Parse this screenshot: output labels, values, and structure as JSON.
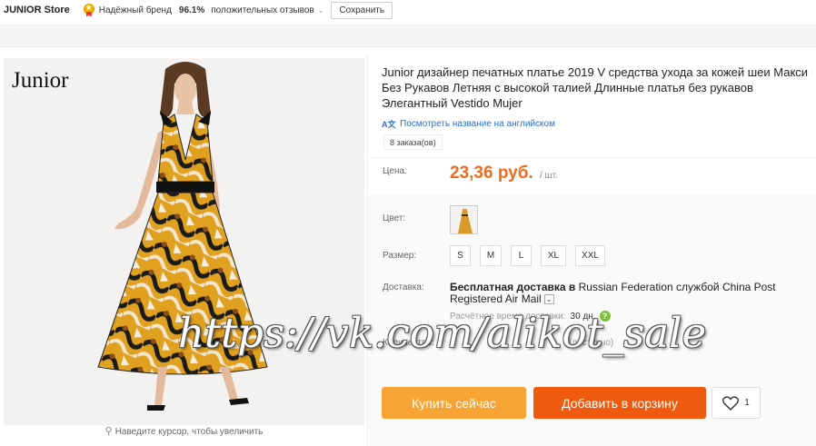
{
  "store": {
    "name": "JUNIOR Store",
    "badge_label": "Надёжный бренд",
    "rating": "96.1%",
    "feedback_label": "положительных отзывов",
    "save_label": "Сохранить"
  },
  "gallery": {
    "logo_text": "Junior",
    "zoom_hint": "Наведите курсор, чтобы увеличить"
  },
  "product": {
    "title": "Junior дизайнер печатных платье 2019 V средства ухода за кожей шеи Макси Без Рукавов Летняя с высокой талией Длинные платья без рукавов Элегантный Vestido Mujer",
    "translate_link": "Посмотреть название на английском",
    "orders": "8 заказа(ов)"
  },
  "price": {
    "label": "Цена:",
    "value": "23,36 руб.",
    "unit": "/ шт."
  },
  "options": {
    "color_label": "Цвет:",
    "size_label": "Размер:",
    "sizes": [
      "S",
      "M",
      "L",
      "XL",
      "XXL"
    ]
  },
  "shipping": {
    "label": "Доставка:",
    "line1_bold": "Бесплатная доставка в",
    "country": "Russian Federation",
    "via": "службой",
    "carrier": "China Post Registered Air Mail",
    "eta_label": "Расчётное время доставки:",
    "eta_value": "30 дн."
  },
  "quantity": {
    "label": "Количество:",
    "available": "(доступно)"
  },
  "actions": {
    "buy_now": "Купить сейчас",
    "add_to_cart": "Добавить в корзину",
    "wishlist_count": "1"
  },
  "watermark": "https://vk.com/alikot_sale",
  "colors": {
    "price": "#f06b1c",
    "buy_now": "#f7a434",
    "add_to_cart": "#ef5a0e",
    "link": "#2d6ec9"
  }
}
